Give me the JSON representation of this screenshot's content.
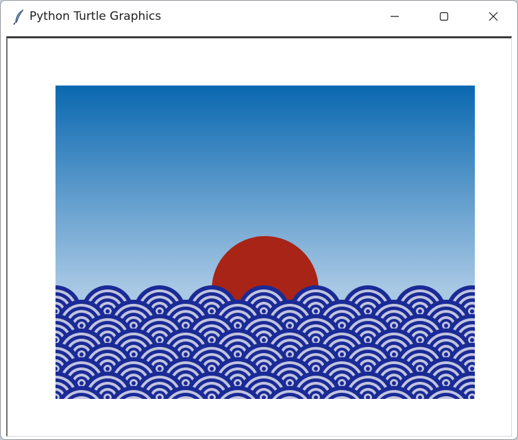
{
  "window": {
    "title": "Python Turtle Graphics",
    "icon": "feather-icon",
    "controls": [
      "minimize-icon",
      "maximize-icon",
      "close-icon"
    ]
  },
  "canvas": {
    "scene": "sunrise-over-seigaiha-waves",
    "colors": {
      "sky_top": "#0a68b0",
      "sky_bottom": "#a8c8e4",
      "sun": "#a82416",
      "wave_dark": "#1a2a96",
      "wave_light": "#c0c4de"
    }
  }
}
